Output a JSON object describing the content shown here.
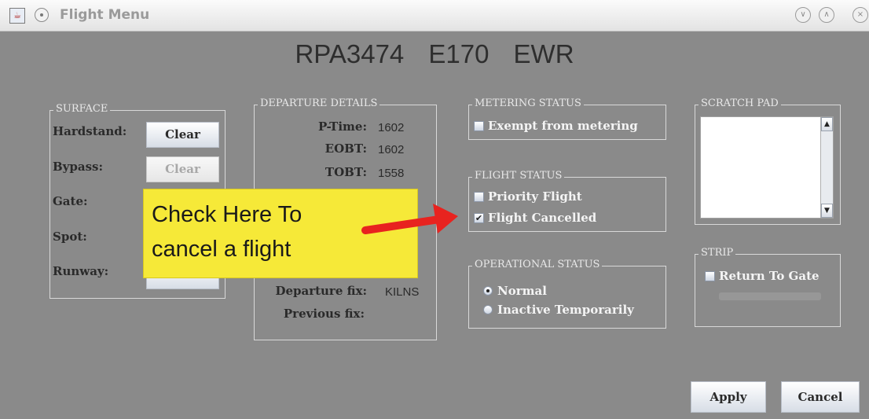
{
  "window": {
    "title": "Flight Menu",
    "app_icon": "java-app-icon",
    "menu_icon": "window-menu-icon",
    "controls": [
      "minimize-icon",
      "maximize-icon",
      "close-icon"
    ]
  },
  "header": {
    "callsign": "RPA3474",
    "aircraft": "E170",
    "airport": "EWR"
  },
  "surface": {
    "legend": "SURFACE",
    "hardstand_label": "Hardstand:",
    "hardstand_button": "Clear",
    "bypass_label": "Bypass:",
    "bypass_button": "Clear",
    "gate_label": "Gate:",
    "spot_label": "Spot:",
    "runway_label": "Runway:"
  },
  "departure": {
    "legend": "DEPARTURE DETAILS",
    "ptime_label": "P-Time:",
    "ptime_value": "1602",
    "eobt_label": "EOBT:",
    "eobt_value": "1602",
    "tobt_label": "TOBT:",
    "tobt_value": "1558",
    "fix_label": "Departure fix:",
    "fix_value": "KILNS",
    "prev_fix_label": "Previous fix:"
  },
  "metering": {
    "legend": "METERING STATUS",
    "exempt_label": "Exempt from metering",
    "exempt_checked": false
  },
  "flight_status": {
    "legend": "FLIGHT STATUS",
    "priority_label": "Priority Flight",
    "priority_checked": false,
    "cancelled_label": "Flight Cancelled",
    "cancelled_checked": true
  },
  "operational": {
    "legend": "OPERATIONAL STATUS",
    "normal_label": "Normal",
    "inactive_label": "Inactive Temporarily",
    "selected": "Normal"
  },
  "scratch_pad": {
    "legend": "SCRATCH PAD",
    "value": ""
  },
  "strip": {
    "legend": "STRIP",
    "return_label": "Return To Gate",
    "return_checked": false
  },
  "actions": {
    "apply": "Apply",
    "cancel": "Cancel"
  },
  "annotation": {
    "line1": "Check Here To",
    "line2": "cancel a flight",
    "arrow_color": "#e8231f",
    "box_color": "#f6e938"
  }
}
